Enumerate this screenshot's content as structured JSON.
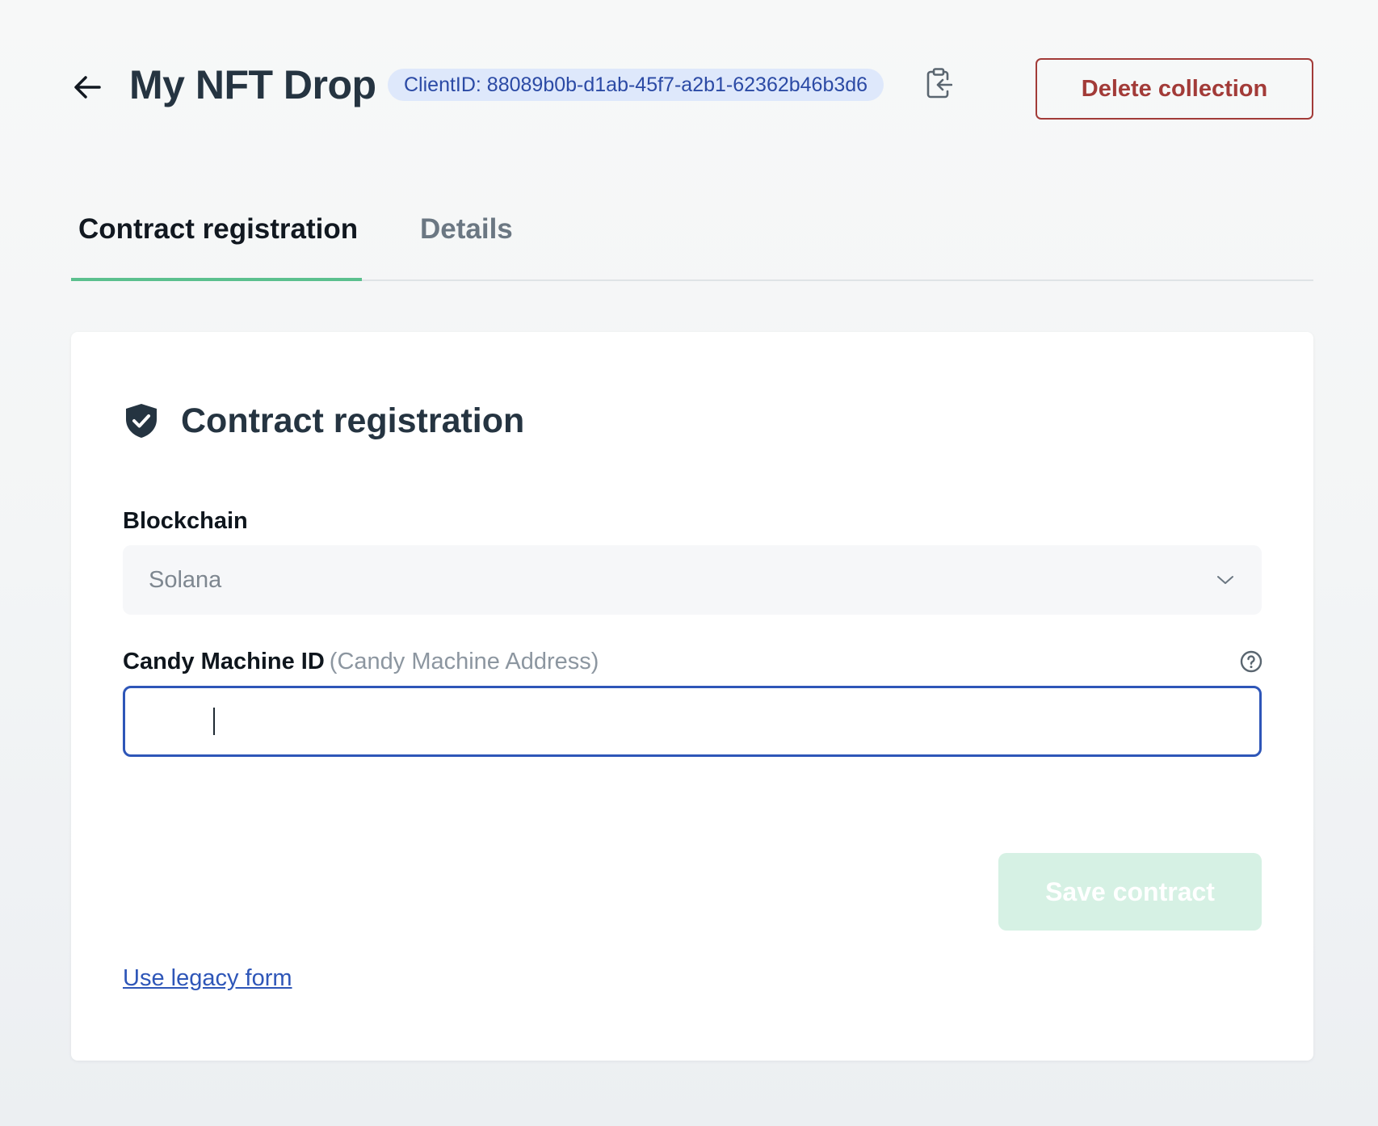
{
  "header": {
    "title": "My NFT Drop",
    "client_id_label": "ClientID: 88089b0b-d1ab-45f7-a2b1-62362b46b3d6",
    "delete_label": "Delete collection"
  },
  "tabs": [
    {
      "label": "Contract registration",
      "active": true
    },
    {
      "label": "Details",
      "active": false
    }
  ],
  "card": {
    "title": "Contract registration",
    "blockchain": {
      "label": "Blockchain",
      "value": "Solana"
    },
    "candy_machine": {
      "label": "Candy Machine ID",
      "sublabel": "(Candy Machine Address)",
      "value": ""
    },
    "save_label": "Save contract",
    "legacy_link": "Use legacy form"
  },
  "colors": {
    "accent_green": "#5bc08e",
    "danger": "#a23b38",
    "focus_blue": "#2e56b8",
    "badge_bg": "#dee8fb",
    "save_disabled_bg": "#d6f1e4"
  },
  "icons": [
    "arrow-left-icon",
    "clipboard-copy-icon",
    "shield-check-icon",
    "chevron-down-icon",
    "question-circle-icon"
  ]
}
